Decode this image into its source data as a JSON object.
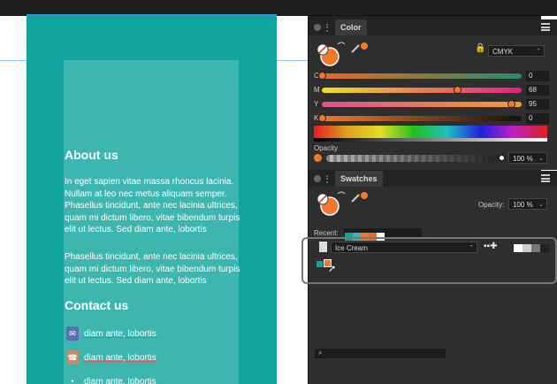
{
  "colors": {
    "teal": "#12a5a0",
    "teal_inner": "#3eb6b0",
    "orange": "#f07a2a",
    "panel": "#2e2e2e"
  },
  "web": {
    "about_title": "About us",
    "about_para1": "In eget sapien vitae massa rhoncus lacinia. Nullam at leo nec metus aliquam semper. Phasellus tincidunt, ante nec lacinia ultrices, quam mi dictum libero, vitae bibendum turpis elit ut lectus. Sed diam ante, lobortis",
    "about_para2": "Phasellus tincidunt, ante nec lacinia ultrices, quam mi dictum libero, vitae bibendum turpis elit ut lectus. Sed diam ante, lobortis",
    "contact_title": "Contact us",
    "contacts": [
      {
        "icon": "mail-icon",
        "text": "diam ante, lobortis"
      },
      {
        "icon": "phone-icon",
        "text": "diam ante, lobortis"
      },
      {
        "icon": "location-icon",
        "text": "diam ante, lobortis"
      }
    ]
  },
  "color_panel": {
    "tab": "Color",
    "mode": "CMYK",
    "channels": [
      {
        "label": "C",
        "value": "0",
        "fraction": 0.0
      },
      {
        "label": "M",
        "value": "68",
        "fraction": 0.68
      },
      {
        "label": "Y",
        "value": "95",
        "fraction": 0.95
      },
      {
        "label": "K",
        "value": "0",
        "fraction": 0.0
      }
    ],
    "opacity_label": "Opacity",
    "opacity_value": "100 %",
    "opacity_fraction": 1.0
  },
  "swatches_panel": {
    "tab": "Swatches",
    "opacity_label": "Opacity:",
    "opacity_value": "100 %",
    "recent_label": "Recent:",
    "recent_colors": [
      "#12a5a0",
      "#3eb6b0",
      "#f07a2a",
      "#e86a20",
      "#ffffff"
    ],
    "palette_name": "Ice Cream",
    "palette_swatches": [
      "#12a5a0",
      "#f07a2a"
    ],
    "grays": [
      "#ffffff",
      "#cccccc",
      "#777777",
      "#222222"
    ]
  }
}
